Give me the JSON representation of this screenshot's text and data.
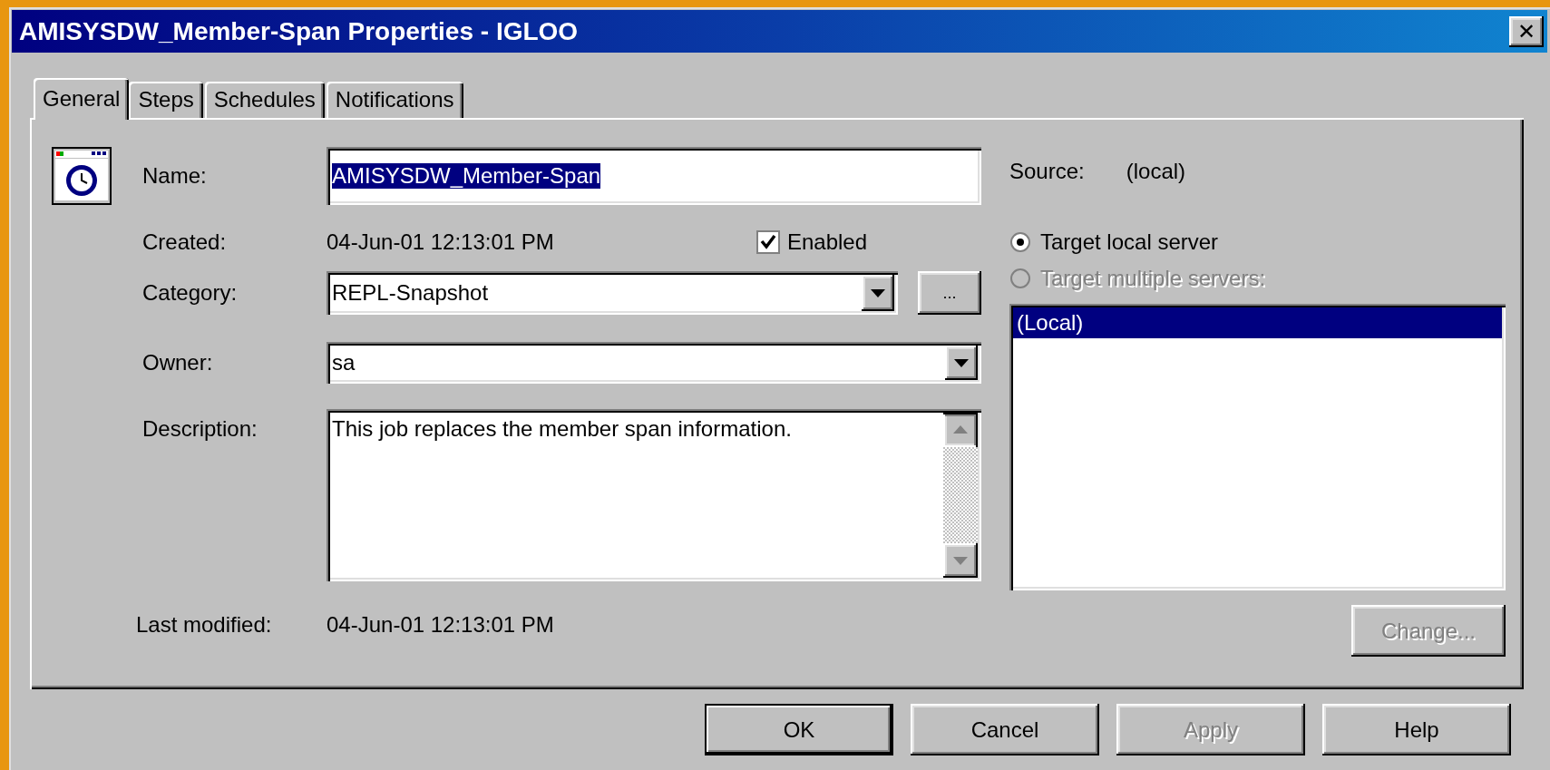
{
  "window": {
    "title": "AMISYSDW_Member-Span Properties - IGLOO",
    "close": "✕"
  },
  "tabs": [
    {
      "label": "General",
      "selected": true
    },
    {
      "label": "Steps",
      "selected": false
    },
    {
      "label": "Schedules",
      "selected": false
    },
    {
      "label": "Notifications",
      "selected": false
    }
  ],
  "name": {
    "label": "Name:",
    "value": "AMISYSDW_Member-Span",
    "text_selected": true
  },
  "created": {
    "label": "Created:",
    "value": "04-Jun-01 12:13:01 PM"
  },
  "enabled": {
    "label": "Enabled",
    "checked": true
  },
  "category": {
    "label": "Category:",
    "value": "REPL-Snapshot",
    "browse": "..."
  },
  "owner": {
    "label": "Owner:",
    "value": "sa"
  },
  "description": {
    "label": "Description:",
    "value": "This job replaces the member span information."
  },
  "last_modified": {
    "label": "Last modified:",
    "value": "04-Jun-01 12:13:01 PM"
  },
  "source": {
    "label": "Source:",
    "value": "(local)"
  },
  "targets": [
    {
      "label": "Target local server",
      "selected": true,
      "disabled": false
    },
    {
      "label": "Target multiple servers:",
      "selected": false,
      "disabled": true
    }
  ],
  "servers": [
    {
      "label": "(Local)",
      "selected": true
    }
  ],
  "change_button": {
    "label": "Change...",
    "disabled": true
  },
  "buttons": [
    {
      "label": "OK",
      "disabled": false,
      "default": true
    },
    {
      "label": "Cancel",
      "disabled": false,
      "default": false
    },
    {
      "label": "Apply",
      "disabled": true,
      "default": false
    },
    {
      "label": "Help",
      "disabled": false,
      "default": false
    }
  ]
}
